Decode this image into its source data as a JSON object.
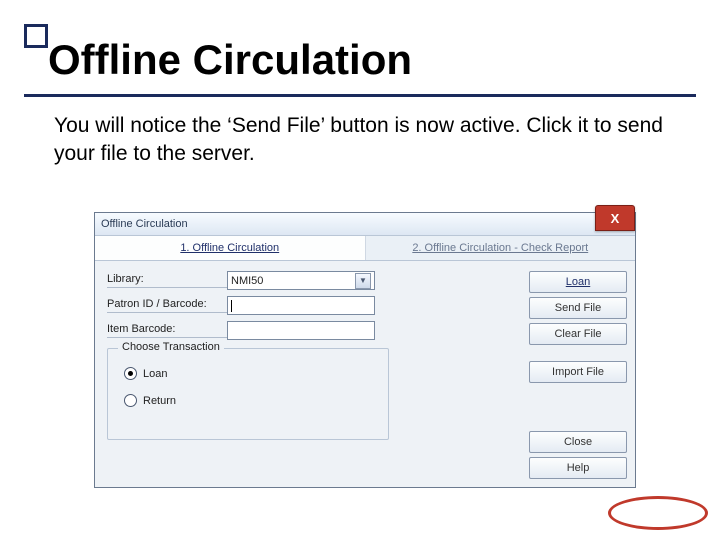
{
  "slide": {
    "title": "Offline Circulation",
    "body": "You will notice the ‘Send File’ button is now active.  Click it to send your file to the server."
  },
  "dialog": {
    "title": "Offline Circulation",
    "close_glyph": "X",
    "tabs": [
      "1. Offline Circulation",
      "2. Offline Circulation - Check Report"
    ],
    "form": {
      "library_label": "Library:",
      "library_value": "NMI50",
      "patron_label": "Patron ID / Barcode:",
      "item_label": "Item Barcode:"
    },
    "group": {
      "title": "Choose Transaction",
      "options": [
        "Loan",
        "Return"
      ]
    },
    "buttons": {
      "loan": "Loan",
      "send_file": "Send File",
      "clear_file": "Clear File",
      "import_file": "Import File",
      "close": "Close",
      "help": "Help"
    }
  }
}
